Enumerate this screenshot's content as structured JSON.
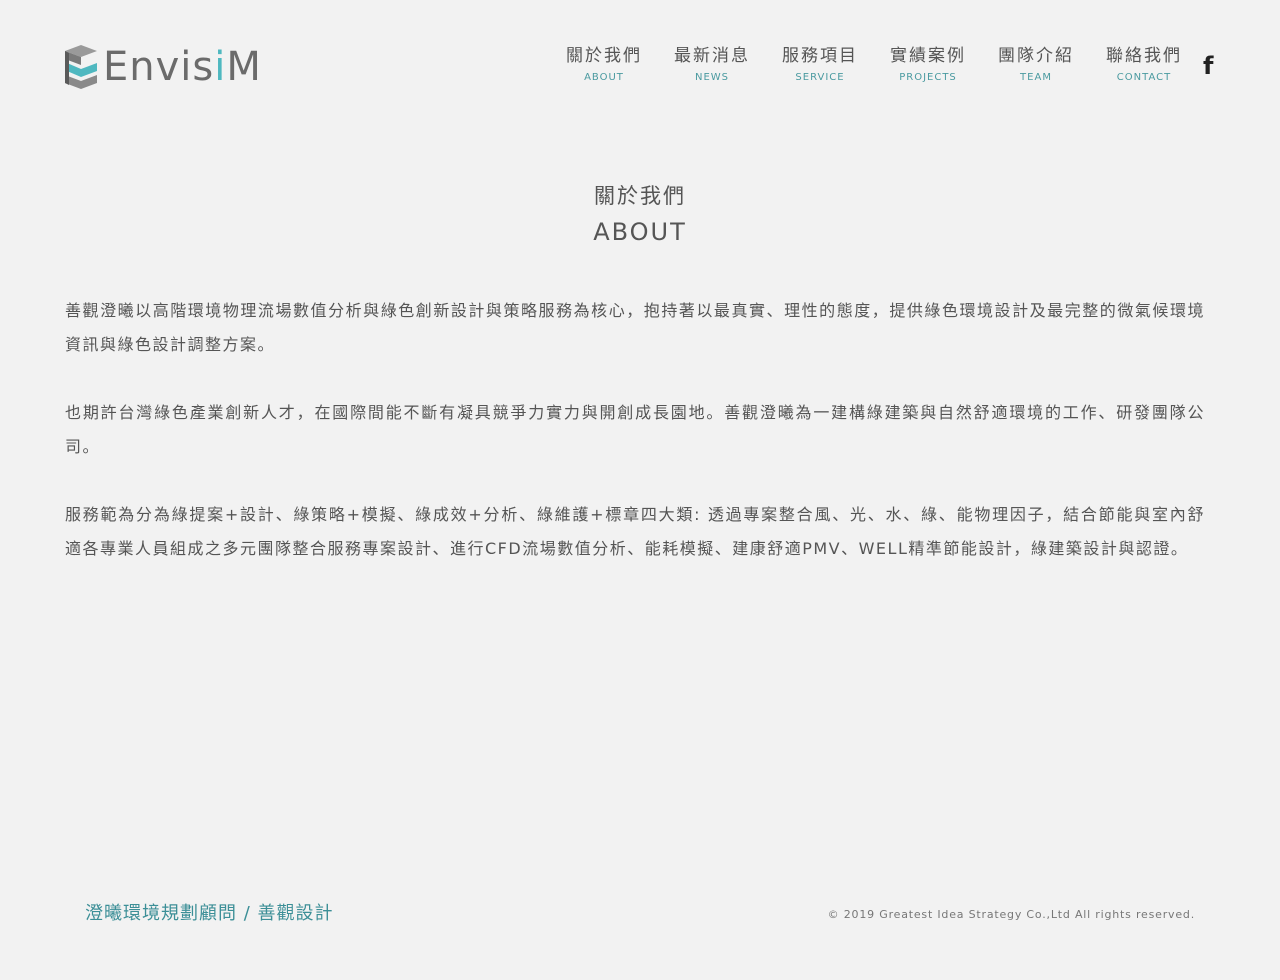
{
  "brand": {
    "logo_main": "Envis",
    "logo_accent": "i",
    "logo_end": "M"
  },
  "nav": [
    {
      "zh": "關於我們",
      "en": "ABOUT"
    },
    {
      "zh": "最新消息",
      "en": "NEWS"
    },
    {
      "zh": "服務項目",
      "en": "SERVICE"
    },
    {
      "zh": "實績案例",
      "en": "PROJECTS"
    },
    {
      "zh": "團隊介紹",
      "en": "TEAM"
    },
    {
      "zh": "聯絡我們",
      "en": "CONTACT"
    }
  ],
  "social": {
    "facebook_glyph": "f"
  },
  "heading": {
    "zh": "關於我們",
    "en": "ABOUT"
  },
  "paragraphs": [
    "善觀澄曦以高階環境物理流場數值分析與綠色創新設計與策略服務為核心，抱持著以最真實、理性的態度，提供綠色環境設計及最完整的微氣候環境資訊與綠色設計調整方案。",
    "也期許台灣綠色產業創新人才，在國際間能不斷有凝具競爭力實力與開創成長園地。善觀澄曦為一建構綠建築與自然舒適環境的工作、研發團隊公司。",
    "服務範為分為綠提案+設計、綠策略+模擬、綠成效+分析、綠維護+標章四大類: 透過專案整合風、光、水、綠、能物理因子，結合節能與室內舒適各專業人員組成之多元團隊整合服務專案設計、進行CFD流場數值分析、能耗模擬、建康舒適PMV、WELL精準節能設計，綠建築設計與認證。"
  ],
  "footer": {
    "company": "澄曦環境規劃顧問 / 善觀設計",
    "copyright": "© 2019 Greatest Idea Strategy Co.,Ltd All rights reserved."
  },
  "colors": {
    "accent": "#4fb8c0",
    "footer_link": "#3c8f97",
    "background": "#f2f2f2"
  }
}
